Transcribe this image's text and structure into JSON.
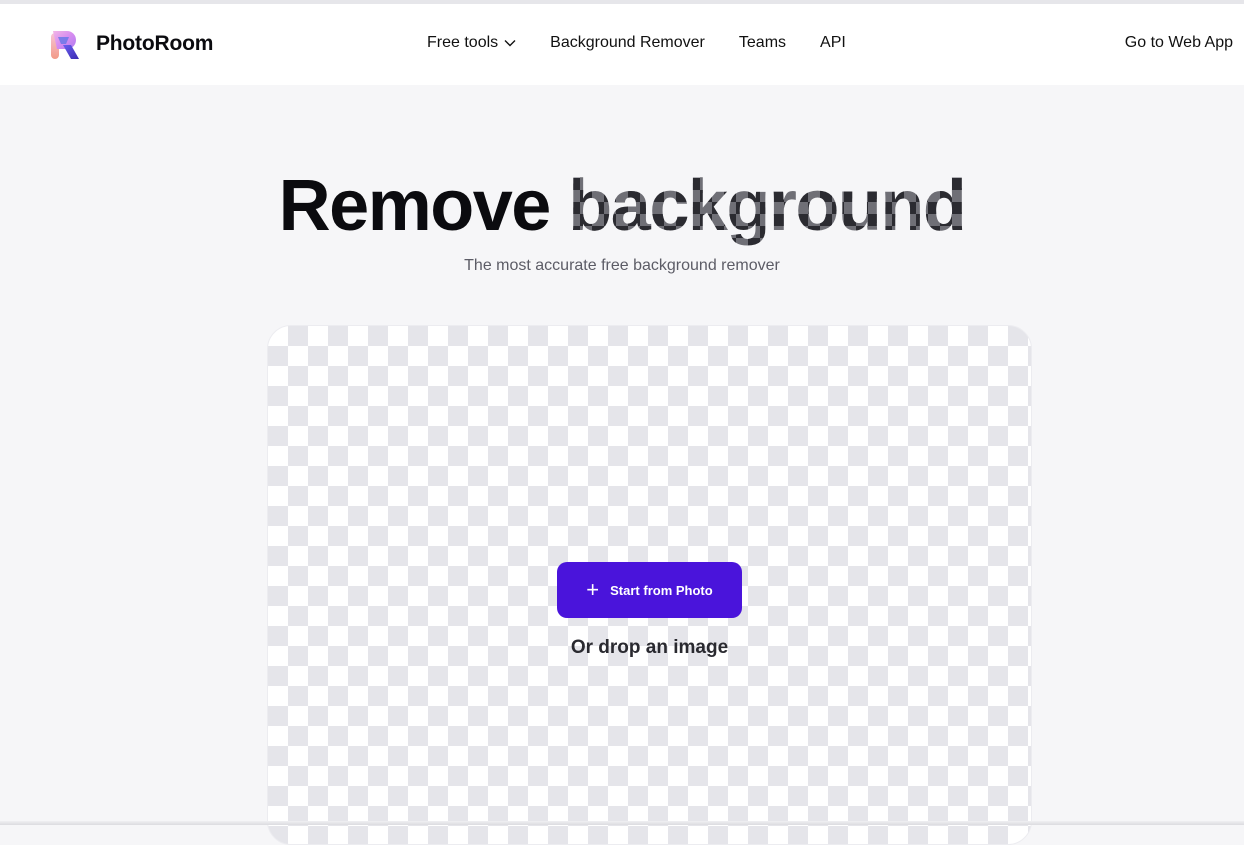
{
  "brand": {
    "name": "PhotoRoom",
    "logo_icon": "photoroom-r-logo-icon",
    "colors": {
      "accent": "#4a14db",
      "page_bg": "#f6f6f8",
      "checker": "#e5e5ea"
    }
  },
  "nav": {
    "items": [
      {
        "label": "Free tools",
        "icon": "chevron-down-icon"
      },
      {
        "label": "Background Remover"
      },
      {
        "label": "Teams"
      },
      {
        "label": "API"
      }
    ],
    "cta": "Go to Web App"
  },
  "hero": {
    "title_plain": "Remove",
    "title_checker": "background",
    "subtitle": "The most accurate free background remover"
  },
  "upload": {
    "button_label": "Start from Photo",
    "button_icon": "plus-icon",
    "drop_label": "Or drop an image"
  }
}
